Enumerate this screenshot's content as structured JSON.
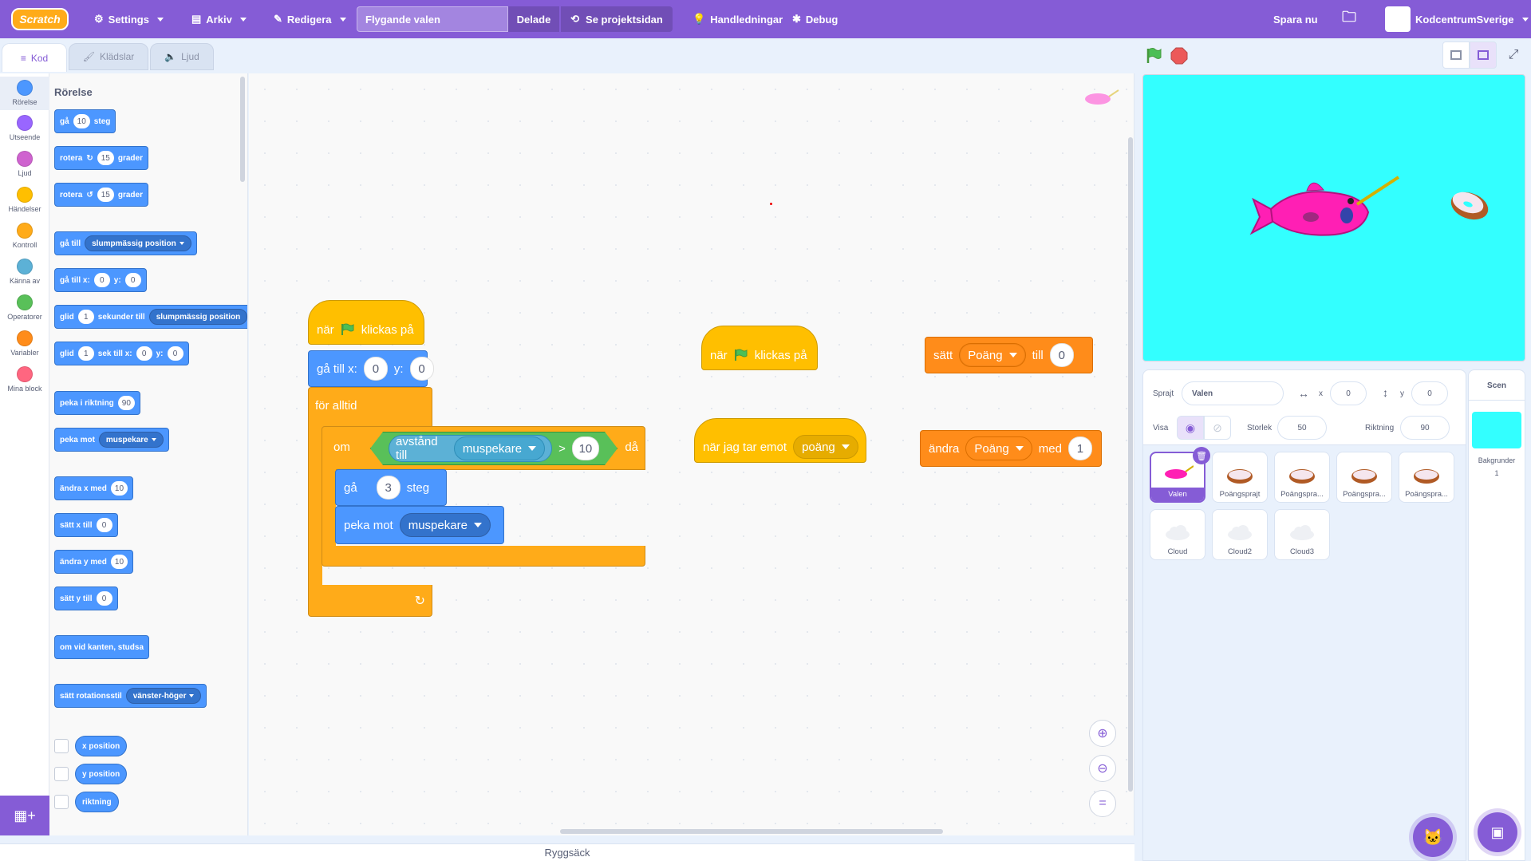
{
  "menubar": {
    "logo": "Scratch",
    "settings": "Settings",
    "file": "Arkiv",
    "edit": "Redigera",
    "project_title": "Flygande valen",
    "shared": "Delade",
    "project_page": "Se projektsidan",
    "tutorials": "Handledningar",
    "debug": "Debug",
    "save_now": "Spara nu",
    "username": "KodcentrumSverige"
  },
  "tabs": {
    "code": "Kod",
    "costumes": "Klädslar",
    "sounds": "Ljud"
  },
  "categories": [
    {
      "label": "Rörelse",
      "color": "#4c97ff"
    },
    {
      "label": "Utseende",
      "color": "#9966ff"
    },
    {
      "label": "Ljud",
      "color": "#cf63cf"
    },
    {
      "label": "Händelser",
      "color": "#ffbf00"
    },
    {
      "label": "Kontroll",
      "color": "#ffab19"
    },
    {
      "label": "Känna av",
      "color": "#5cb1d6"
    },
    {
      "label": "Operatorer",
      "color": "#59c059"
    },
    {
      "label": "Variabler",
      "color": "#ff8c1a"
    },
    {
      "label": "Mina block",
      "color": "#ff6680"
    }
  ],
  "palette": {
    "title": "Rörelse",
    "move": {
      "label": "gå",
      "value": "10",
      "unit": "steg"
    },
    "turn_right": {
      "label": "rotera",
      "value": "15",
      "unit": "grader"
    },
    "turn_left": {
      "label": "rotera",
      "value": "15",
      "unit": "grader"
    },
    "goto": {
      "label": "gå till",
      "option": "slumpmässig position"
    },
    "goto_xy": {
      "label": "gå till x:",
      "x": "0",
      "ylabel": "y:",
      "y": "0"
    },
    "glide": {
      "label": "glid",
      "secs": "1",
      "mid": "sekunder till",
      "option": "slumpmässig position"
    },
    "glide_xy": {
      "label": "glid",
      "secs": "1",
      "mid": "sek till x:",
      "x": "0",
      "ylabel": "y:",
      "y": "0"
    },
    "point_dir": {
      "label": "peka i riktning",
      "value": "90"
    },
    "point_towards": {
      "label": "peka mot",
      "option": "muspekare"
    },
    "change_x": {
      "label": "ändra x med",
      "value": "10"
    },
    "set_x": {
      "label": "sätt x till",
      "value": "0"
    },
    "change_y": {
      "label": "ändra y med",
      "value": "10"
    },
    "set_y": {
      "label": "sätt y till",
      "value": "0"
    },
    "bounce": {
      "label": "om vid kanten, studsa"
    },
    "rotation_style": {
      "label": "sätt rotationsstil",
      "option": "vänster-höger"
    },
    "reporters": [
      "x position",
      "y position",
      "riktning"
    ]
  },
  "scripts": {
    "s1": {
      "hat": {
        "pre": "när",
        "post": "klickas på"
      },
      "goto": {
        "label": "gå till x:",
        "x": "0",
        "ylabel": "y:",
        "y": "0"
      },
      "forever": "för alltid",
      "if": {
        "label": "om",
        "then": "då",
        "sensor": "avstånd till",
        "target": "muspekare",
        "op": ">",
        "value": "10"
      },
      "move": {
        "label": "gå",
        "value": "3",
        "unit": "steg"
      },
      "point": {
        "label": "peka mot",
        "target": "muspekare"
      }
    },
    "s2": {
      "pre": "när",
      "post": "klickas på"
    },
    "s3": {
      "label": "när jag tar emot",
      "message": "poäng"
    },
    "s4": {
      "label": "sätt",
      "var": "Poäng",
      "mid": "till",
      "value": "0"
    },
    "s5": {
      "label": "ändra",
      "var": "Poäng",
      "mid": "med",
      "value": "1"
    }
  },
  "backpack": "Ryggsäck",
  "sprite_info": {
    "sprite_label": "Sprajt",
    "sprite_name": "Valen",
    "x_label": "x",
    "x": "0",
    "y_label": "y",
    "y": "0",
    "show_label": "Visa",
    "size_label": "Storlek",
    "size": "50",
    "direction_label": "Riktning",
    "direction": "90"
  },
  "sprites": [
    {
      "name": "Valen",
      "selected": true
    },
    {
      "name": "Poängsprajt"
    },
    {
      "name": "Poängspra..."
    },
    {
      "name": "Poängspra..."
    },
    {
      "name": "Poängspra..."
    },
    {
      "name": "Cloud"
    },
    {
      "name": "Cloud2"
    },
    {
      "name": "Cloud3"
    }
  ],
  "stage_panel": {
    "title": "Scen",
    "backdrops_label": "Bakgrunder",
    "backdrops_count": "1"
  },
  "colors": {
    "accent": "#855cd6",
    "stage_bg": "#33ffff",
    "motion": "#4c97ff",
    "control": "#ffab19",
    "events": "#ffbf00",
    "variables": "#ff8c1a",
    "operators": "#59c059",
    "sensing": "#5cb1d6"
  }
}
